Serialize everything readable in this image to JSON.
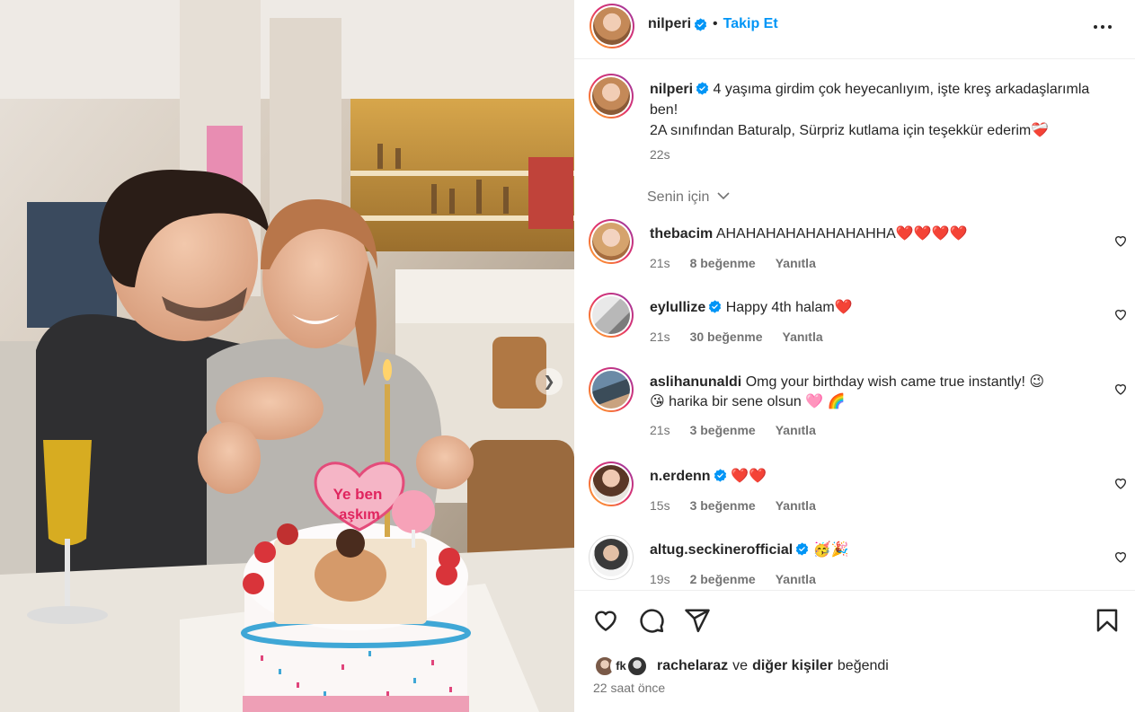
{
  "post": {
    "author": "nilperi",
    "follow_label": "Takip Et",
    "separator": "•",
    "caption_line1": "4 yaşıma girdim çok heyecanlıyım, işte kreş arkadaşlarımla ben!",
    "caption_line2": "2A sınıfından Baturalp, Sürpriz kutlama için teşekkür ederim❤️‍🩹",
    "caption_time": "22s",
    "cake_text_1": "Ye ben",
    "cake_text_2": "aşkım"
  },
  "filter": {
    "label": "Senin için"
  },
  "comments": [
    {
      "user": "thebacim",
      "text": "AHAHAHAHAHAHAHAHHA❤️❤️❤️❤️",
      "time": "21s",
      "likes": "8 beğenme",
      "reply": "Yanıtla",
      "verified": false
    },
    {
      "user": "eylullize",
      "text": "Happy 4th halam❤️",
      "time": "21s",
      "likes": "30 beğenme",
      "reply": "Yanıtla",
      "verified": true
    },
    {
      "user": "aslihanunaldi",
      "text": "Omg your birthday wish came true instantly! 😉",
      "text2": "😘 harika bir sene olsun 🩷 🌈",
      "time": "21s",
      "likes": "3 beğenme",
      "reply": "Yanıtla",
      "verified": false
    },
    {
      "user": "n.erdenn",
      "text": "❤️❤️",
      "time": "15s",
      "likes": "3 beğenme",
      "reply": "Yanıtla",
      "verified": true
    },
    {
      "user": "altug.seckinerofficial",
      "text": "🥳🎉",
      "time": "19s",
      "likes": "2 beğenme",
      "reply": "Yanıtla",
      "verified": true
    }
  ],
  "likes": {
    "liker": "rachelaraz",
    "and": "ve",
    "others": "diğer kişiler",
    "liked": "beğendi",
    "posted_ago": "22 saat önce"
  },
  "colors": {
    "accent": "#0095f6",
    "verified": "#0095f6",
    "muted": "#737373"
  },
  "icons": [
    "more-options-icon",
    "verified-badge-icon",
    "chevron-down-icon",
    "heart-icon",
    "comment-icon",
    "share-icon",
    "bookmark-icon",
    "carousel-next-icon"
  ]
}
